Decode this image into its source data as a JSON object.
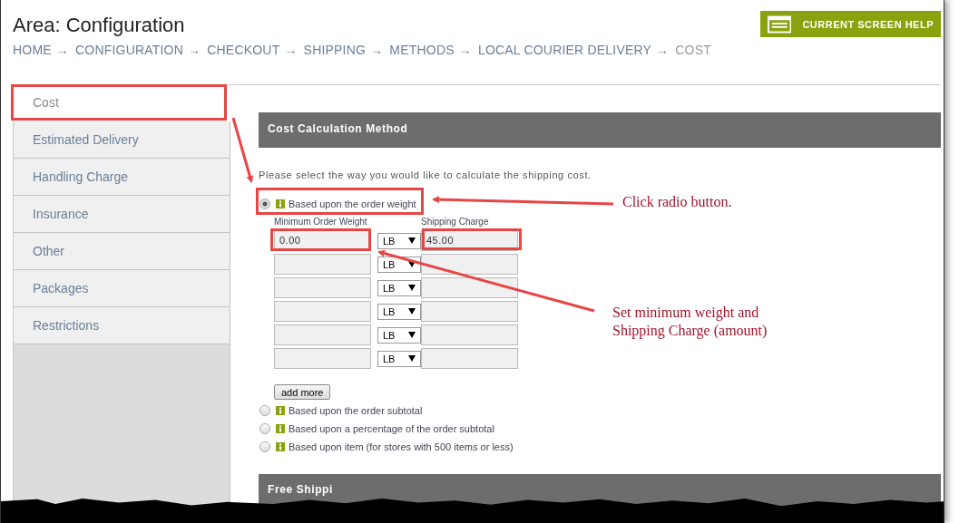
{
  "header": {
    "title": "Area: Configuration",
    "help_button": "CURRENT SCREEN HELP",
    "breadcrumb": [
      {
        "label": "HOME",
        "current": false
      },
      {
        "label": "CONFIGURATION",
        "current": false
      },
      {
        "label": "CHECKOUT",
        "current": false
      },
      {
        "label": "SHIPPING",
        "current": false
      },
      {
        "label": "METHODS",
        "current": false
      },
      {
        "label": "LOCAL COURIER DELIVERY",
        "current": false
      },
      {
        "label": "COST",
        "current": true
      }
    ],
    "separator": "→"
  },
  "sidebar": {
    "items": [
      {
        "label": "Cost",
        "selected": true
      },
      {
        "label": "Estimated Delivery",
        "selected": false
      },
      {
        "label": "Handling Charge",
        "selected": false
      },
      {
        "label": "Insurance",
        "selected": false
      },
      {
        "label": "Other",
        "selected": false
      },
      {
        "label": "Packages",
        "selected": false
      },
      {
        "label": "Restrictions",
        "selected": false
      }
    ]
  },
  "section": {
    "title": "Cost Calculation Method",
    "prompt": "Please select the way you would like to calculate the shipping cost.",
    "options": [
      {
        "label": "Based upon the order weight",
        "selected": true,
        "details": {
          "columns": [
            "Minimum Order Weight",
            "Shipping Charge"
          ],
          "rows": [
            {
              "min_weight": "0.00",
              "unit": "LB",
              "charge": "45.00"
            },
            {
              "unit": "LB"
            },
            {
              "unit": "LB"
            },
            {
              "unit": "LB"
            },
            {
              "unit": "LB"
            },
            {
              "unit": "LB"
            }
          ],
          "add_button": "add more"
        }
      },
      {
        "label": "Based upon the order subtotal",
        "selected": false
      },
      {
        "label": "Based upon a percentage of the order subtotal",
        "selected": false
      },
      {
        "label": "Based upon item (for stores with 500 items or less)",
        "selected": false
      }
    ]
  },
  "next_section": {
    "title": "Free Shippi"
  },
  "annotations": [
    {
      "text": "Click radio button."
    },
    {
      "text": "Set minimum weight and Shipping Charge (amount)"
    }
  ]
}
